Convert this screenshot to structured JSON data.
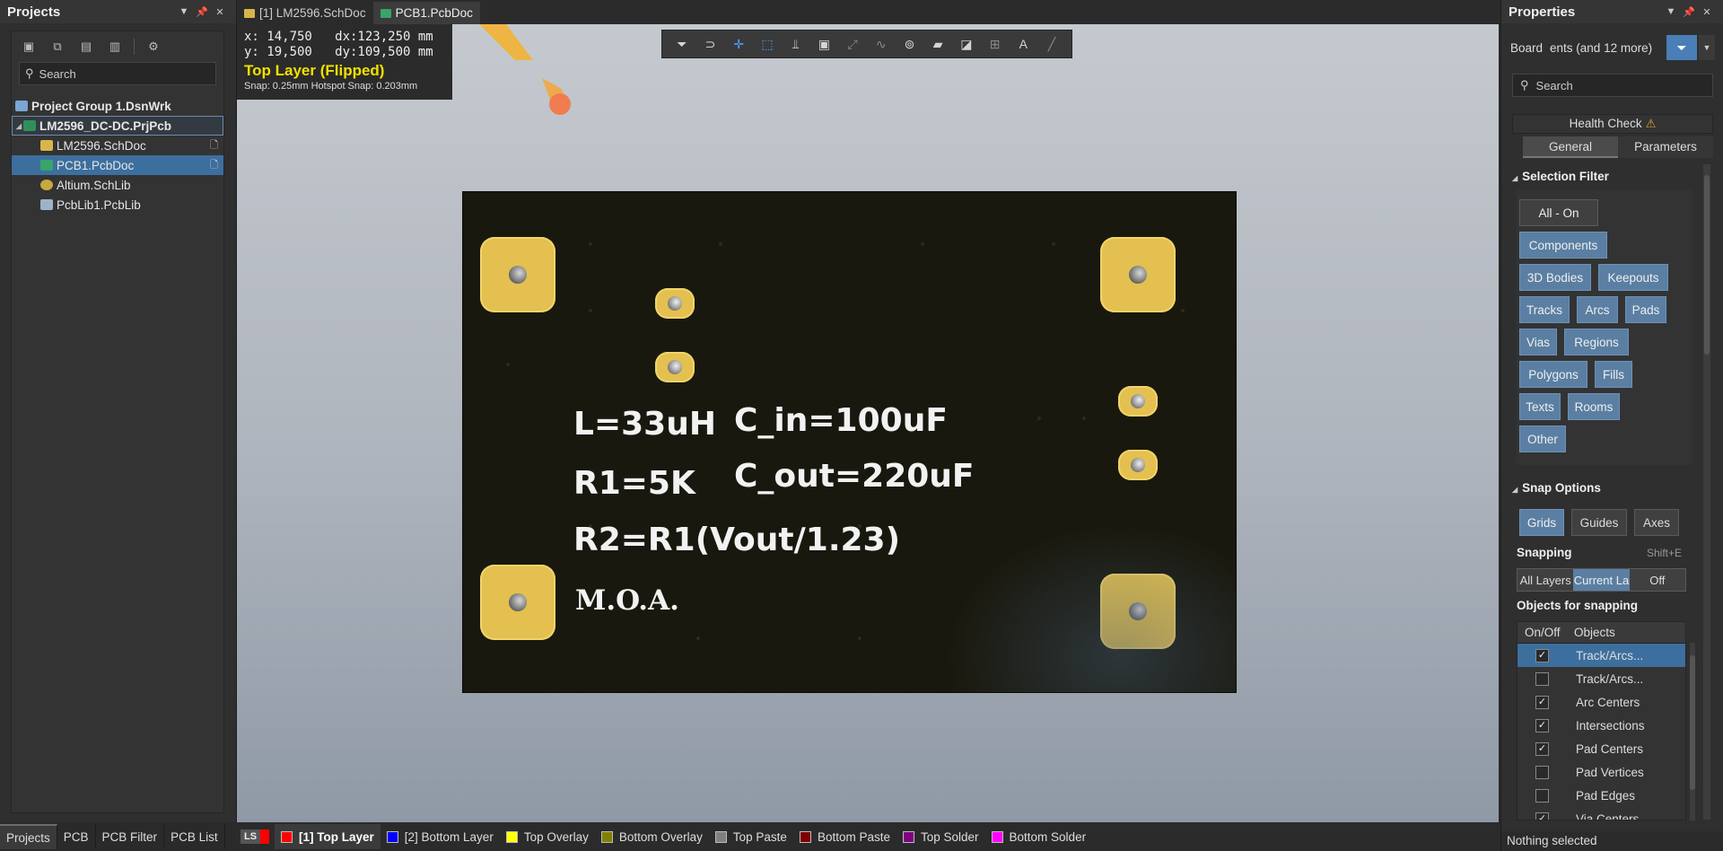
{
  "projects_panel": {
    "title": "Projects",
    "search_placeholder": "Search",
    "tree": [
      {
        "label": "Project Group 1.DsnWrk"
      },
      {
        "label": "LM2596_DC-DC.PrjPcb"
      },
      {
        "label": "LM2596.SchDoc"
      },
      {
        "label": "PCB1.PcbDoc"
      },
      {
        "label": "Altium.SchLib"
      },
      {
        "label": "PcbLib1.PcbLib"
      }
    ],
    "bottom_tabs": [
      "Projects",
      "PCB",
      "PCB Filter",
      "PCB List"
    ]
  },
  "doc_tabs": [
    "[1] LM2596.SchDoc",
    "PCB1.PcbDoc"
  ],
  "hud": {
    "x_line": "x: 14,750   dx:123,250 mm",
    "y_line": "y: 19,500   dy:109,500 mm",
    "layer": "Top Layer (Flipped)",
    "snap": "Snap: 0.25mm Hotspot Snap: 0.203mm"
  },
  "board_text": {
    "l": "L=33uH",
    "cin": "C_in=100uF",
    "r1": "R1=5K",
    "cout": "C_out=220uF",
    "r2": "R2=R1(Vout/1.23)",
    "moa": "M.O.A."
  },
  "layer_bar": {
    "ls": "LS",
    "tabs": [
      {
        "label": "[1] Top Layer",
        "color": "#ff0000"
      },
      {
        "label": "[2] Bottom Layer",
        "color": "#0000ff"
      },
      {
        "label": "Top Overlay",
        "color": "#ffff00"
      },
      {
        "label": "Bottom Overlay",
        "color": "#808000"
      },
      {
        "label": "Top Paste",
        "color": "#808080"
      },
      {
        "label": "Bottom Paste",
        "color": "#800000"
      },
      {
        "label": "Top Solder",
        "color": "#800080"
      },
      {
        "label": "Bottom Solder",
        "color": "#ff00ff"
      }
    ]
  },
  "properties": {
    "title": "Properties",
    "board_label": "Board",
    "board_filter": "ents (and 12 more)",
    "search_placeholder": "Search",
    "health_check": "Health Check",
    "tabs": [
      "General",
      "Parameters"
    ],
    "selection_filter": {
      "title": "Selection Filter",
      "buttons": [
        "All - On",
        "Components",
        "3D Bodies",
        "Keepouts",
        "Tracks",
        "Arcs",
        "Pads",
        "Vias",
        "Regions",
        "Polygons",
        "Fills",
        "Texts",
        "Rooms",
        "Other"
      ]
    },
    "snap_options": {
      "title": "Snap Options",
      "buttons": [
        "Grids",
        "Guides",
        "Axes"
      ],
      "snapping_label": "Snapping",
      "snapping_shortcut": "Shift+E",
      "snapping_modes": [
        "All Layers",
        "Current La",
        "Off"
      ],
      "objects_label": "Objects for snapping",
      "columns": [
        "On/Off",
        "Objects"
      ],
      "rows": [
        {
          "name": "Track/Arcs...",
          "checked": true
        },
        {
          "name": "Track/Arcs...",
          "checked": false
        },
        {
          "name": "Arc Centers",
          "checked": true
        },
        {
          "name": "Intersections",
          "checked": true
        },
        {
          "name": "Pad Centers",
          "checked": true
        },
        {
          "name": "Pad Vertices",
          "checked": false
        },
        {
          "name": "Pad Edges",
          "checked": false
        },
        {
          "name": "Via Centers",
          "checked": true
        }
      ]
    },
    "status": "Nothing selected"
  }
}
